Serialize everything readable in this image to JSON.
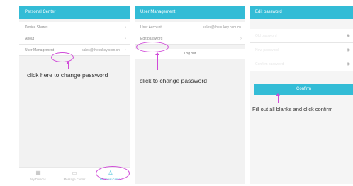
{
  "screen1": {
    "title": "Personal Center",
    "rows": [
      "Device Shares",
      "About"
    ],
    "user_row": {
      "label": "User Management",
      "value": "sales@thesukey.com.cn"
    },
    "annotation": "click here to change password",
    "tabs": [
      {
        "icon": "devices-icon",
        "glyph": "▦",
        "label": "My Devices"
      },
      {
        "icon": "message-icon",
        "glyph": "▭",
        "label": "Message Center"
      },
      {
        "icon": "person-icon",
        "glyph": "♙",
        "label": "Personal Center"
      }
    ]
  },
  "screen2": {
    "title": "User Management",
    "account": {
      "label": "User Account",
      "value": "sales@thesukey.com.cn"
    },
    "edit_password": "Edit password",
    "logout": "Log out",
    "annotation": "click to change password"
  },
  "screen3": {
    "title": "Edit password",
    "fields": [
      {
        "placeholder": "Old password",
        "icon": "eye-icon",
        "glyph": "◉"
      },
      {
        "placeholder": "New password",
        "icon": "eye-icon",
        "glyph": "◉"
      },
      {
        "placeholder": "Confirm password",
        "icon": "eye-icon",
        "glyph": "◉"
      }
    ],
    "confirm": "Confirm",
    "annotation": "Fill out all blanks and click confirm"
  },
  "colors": {
    "accent": "#33bcd6",
    "highlight": "#d04ad8"
  }
}
